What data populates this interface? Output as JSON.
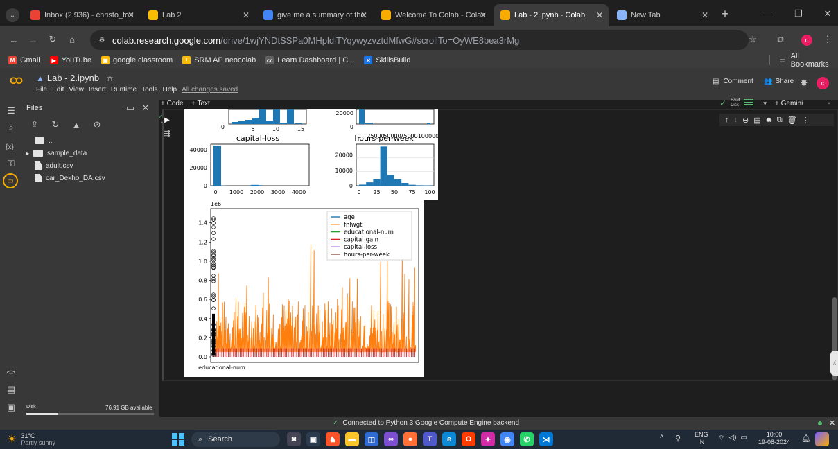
{
  "browser": {
    "tabs": [
      {
        "label": "Inbox (2,936) - christo_ton",
        "favicon": "gmail-icon",
        "color": "#ea4335"
      },
      {
        "label": "Lab 2",
        "favicon": "slides-icon",
        "color": "#fbbc04"
      },
      {
        "label": "give me a summary of the",
        "favicon": "google-icon",
        "color": "#4285f4"
      },
      {
        "label": "Welcome To Colab - Colab",
        "favicon": "colab-icon",
        "color": "#f9ab00"
      },
      {
        "label": "Lab - 2.ipynb - Colab",
        "favicon": "colab-icon",
        "color": "#f9ab00",
        "active": true
      },
      {
        "label": "New Tab",
        "favicon": "chrome-icon",
        "color": "#8ab4f8"
      }
    ],
    "url_host": "colab.research.google.com",
    "url_path": "/drive/1wjYNDtSSPa0MHpldiTYqywyzvztdMfwG#scrollTo=OyWE8bea3rMg",
    "bookmarks": [
      {
        "label": "Gmail",
        "color": "#ea4335",
        "icon": "M"
      },
      {
        "label": "YouTube",
        "color": "#ff0000",
        "icon": "▶"
      },
      {
        "label": "google classroom",
        "color": "#fbbc04",
        "icon": "▣"
      },
      {
        "label": "SRM AP neocolab",
        "color": "#fbbc04",
        "icon": "!"
      },
      {
        "label": "Learn Dashboard | C...",
        "color": "#616161",
        "icon": "cc"
      },
      {
        "label": "SkillsBuild",
        "color": "#1a73e8",
        "icon": "✕"
      }
    ],
    "all_bookmarks": "All Bookmarks",
    "profile_initial": "c"
  },
  "colab": {
    "title": "Lab - 2.ipynb",
    "menu": [
      "File",
      "Edit",
      "View",
      "Insert",
      "Runtime",
      "Tools",
      "Help"
    ],
    "saved_status": "All changes saved",
    "comment_label": "Comment",
    "share_label": "Share",
    "add_code": "+ Code",
    "add_text": "+ Text",
    "ram_label": "RAM",
    "disk_label": "Disk",
    "gemini_label": "+ Gemini",
    "logo": "CO"
  },
  "files_panel": {
    "title": "Files",
    "parent": "..",
    "items": [
      {
        "name": "sample_data",
        "type": "folder"
      },
      {
        "name": "adult.csv",
        "type": "file"
      },
      {
        "name": "car_Dekho_DA.csv",
        "type": "file"
      }
    ],
    "disk_label": "Disk",
    "disk_available": "76.91 GB available",
    "disk_used_fraction": 0.25
  },
  "status_bar": {
    "message": "Connected to Python 3 Google Compute Engine backend"
  },
  "taskbar": {
    "weather_temp": "31°C",
    "weather_desc": "Partly sunny",
    "search": "Search",
    "lang": "ENG",
    "region": "IN",
    "time": "10:00",
    "date": "19-08-2024"
  },
  "chart_data": [
    {
      "type": "bar",
      "title": "",
      "xtick_labels": [
        "5",
        "10",
        "15"
      ],
      "ytick_labels": [
        "0"
      ],
      "note": "partial histogram (educational-num), top cut off"
    },
    {
      "type": "bar",
      "title": "",
      "xtick_labels": [
        "0",
        "25000",
        "50000",
        "75000",
        "100000"
      ],
      "ytick_labels": [
        "0",
        "20000"
      ],
      "note": "partial histogram (capital-gain), top cut off"
    },
    {
      "type": "bar",
      "title": "capital-loss",
      "xtick_labels": [
        "0",
        "1000",
        "2000",
        "3000",
        "4000"
      ],
      "ytick_labels": [
        "0",
        "20000",
        "40000"
      ],
      "x": [
        0,
        200,
        1800,
        2000
      ],
      "values": [
        44500,
        300,
        900,
        600
      ],
      "ylim": [
        0,
        46000
      ]
    },
    {
      "type": "bar",
      "title": "hours-per-week",
      "xtick_labels": [
        "0",
        "25",
        "50",
        "75",
        "100"
      ],
      "ytick_labels": [
        "0",
        "10000",
        "20000"
      ],
      "x": [
        5,
        15,
        25,
        35,
        45,
        55,
        65,
        75,
        85,
        95
      ],
      "values": [
        700,
        2200,
        4200,
        25500,
        7000,
        4200,
        1800,
        600,
        300,
        200
      ],
      "ylim": [
        0,
        27000
      ]
    },
    {
      "type": "line",
      "title": "",
      "offset_label": "1e6",
      "ytick_labels": [
        "0.0",
        "0.2",
        "0.4",
        "0.6",
        "0.8",
        "1.0",
        "1.2",
        "1.4"
      ],
      "ylim": [
        0,
        1.55
      ],
      "xtick_label": "educational-num",
      "series": [
        {
          "name": "age",
          "color": "#1f77b4"
        },
        {
          "name": "fnlwgt",
          "color": "#ff7f0e"
        },
        {
          "name": "educational-num",
          "color": "#2ca02c"
        },
        {
          "name": "capital-gain",
          "color": "#d62728"
        },
        {
          "name": "capital-loss",
          "color": "#9467bd"
        },
        {
          "name": "hours-per-week",
          "color": "#8c564b"
        }
      ]
    }
  ]
}
